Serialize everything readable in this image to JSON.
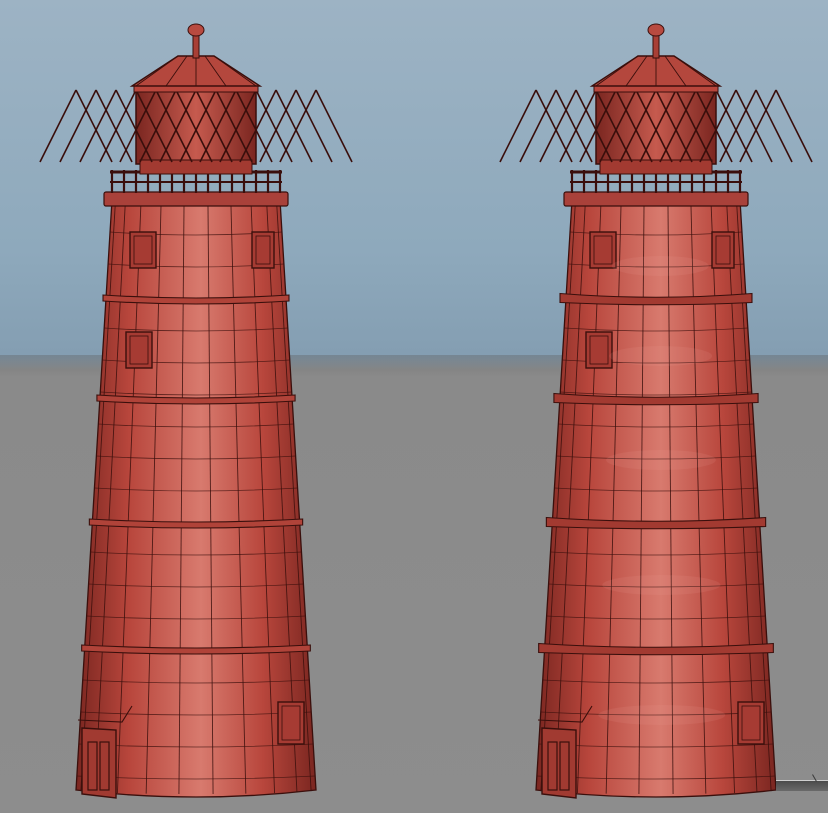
{
  "scene": {
    "description_visible_text": "",
    "models": [
      {
        "id": "lighthouse-low-poly",
        "label": "",
        "surface": "flat"
      },
      {
        "id": "lighthouse-subdivided",
        "label": "",
        "surface": "smooth"
      }
    ]
  },
  "colors": {
    "sky_top": "#9db3c4",
    "sky_bottom": "#849eb2",
    "ground": "#8d8d8d",
    "tower_base": "#b8463c",
    "tower_light": "#d87a6e",
    "tower_dark": "#7a2620",
    "wire": "#3a0f0c"
  },
  "icons": [
    "lighthouse-icon",
    "lantern-icon",
    "railing-icon",
    "window-icon",
    "door-icon"
  ]
}
